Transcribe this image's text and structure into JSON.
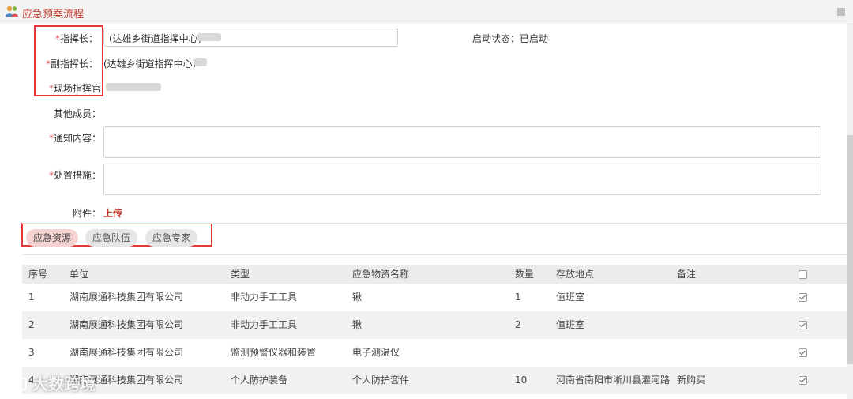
{
  "window": {
    "title": "应急预案流程"
  },
  "form": {
    "commander": {
      "label": "指挥长：",
      "value": "(达雄乡街道指挥中心)"
    },
    "deputy": {
      "label": "副指挥长：",
      "value": "(达雄乡街道指挥中心)"
    },
    "field_commander": {
      "label": "现场指挥官"
    },
    "others": {
      "label": "其他成员："
    },
    "notice": {
      "label": "通知内容：",
      "value": ""
    },
    "measures": {
      "label": "处置措施：",
      "value": ""
    },
    "attachment": {
      "label": "附件：",
      "upload": "上传"
    },
    "status": {
      "label": "启动状态：",
      "value": "已启动"
    }
  },
  "tabs": [
    {
      "label": "应急资源",
      "active": true
    },
    {
      "label": "应急队伍",
      "active": false
    },
    {
      "label": "应急专家",
      "active": false
    }
  ],
  "table": {
    "headers": [
      "序号",
      "单位",
      "类型",
      "应急物资名称",
      "数量",
      "存放地点",
      "备注"
    ],
    "rows": [
      {
        "no": "1",
        "unit": "湖南展通科技集团有限公司",
        "type": "非动力手工工具",
        "name": "锹",
        "qty": "1",
        "place": "值班室",
        "note": "",
        "checked": true
      },
      {
        "no": "2",
        "unit": "湖南展通科技集团有限公司",
        "type": "非动力手工工具",
        "name": "锹",
        "qty": "2",
        "place": "值班室",
        "note": "",
        "checked": true
      },
      {
        "no": "3",
        "unit": "湖南展通科技集团有限公司",
        "type": "监测预警仪器和装置",
        "name": "电子测温仪",
        "qty": "",
        "place": "",
        "note": "",
        "checked": true
      },
      {
        "no": "4",
        "unit": "湖南展通科技集团有限公司",
        "type": "个人防护装备",
        "name": "个人防护套件",
        "qty": "10",
        "place": "河南省南阳市淅川县灌河路",
        "note": "新购买",
        "checked": true
      }
    ]
  },
  "watermark": "大数跨境",
  "colors": {
    "accent": "#c0392b",
    "required": "#d9534f",
    "highlight": "#e23a3a"
  }
}
